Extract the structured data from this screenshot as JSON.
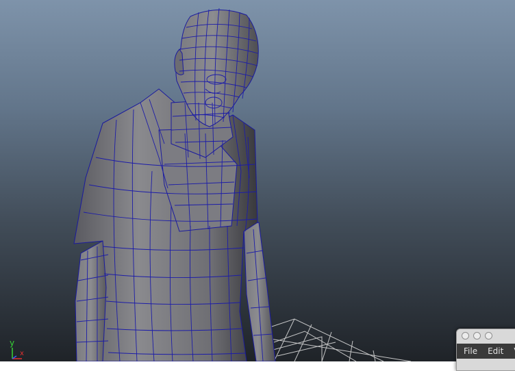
{
  "viewport": {
    "axis": {
      "y_label": "y",
      "x_label": "x"
    }
  },
  "mini_window": {
    "menu": [
      "File",
      "Edit",
      "V"
    ]
  }
}
